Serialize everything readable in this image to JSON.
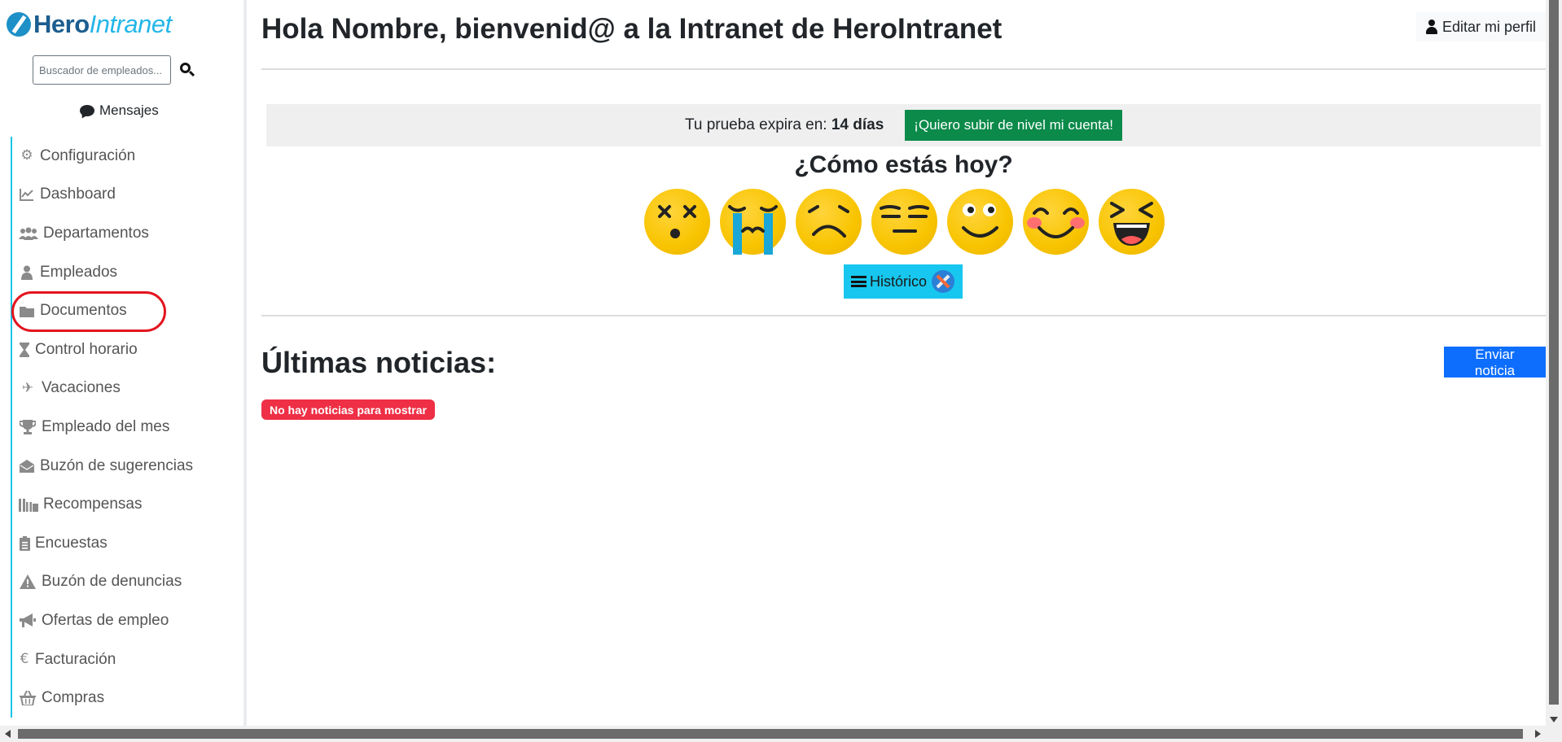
{
  "logo": {
    "hero": "Hero",
    "intranet": "Intranet"
  },
  "search": {
    "placeholder": "Buscador de empleados..."
  },
  "sidebar": {
    "messages_label": "Mensajes",
    "items": [
      {
        "label": "Configuración",
        "icon": "gear-icon"
      },
      {
        "label": "Dashboard",
        "icon": "chart-line-icon"
      },
      {
        "label": "Departamentos",
        "icon": "users-icon"
      },
      {
        "label": "Empleados",
        "icon": "user-icon"
      },
      {
        "label": "Documentos",
        "icon": "folder-icon"
      },
      {
        "label": "Control horario",
        "icon": "hourglass-icon"
      },
      {
        "label": "Vacaciones",
        "icon": "plane-icon"
      },
      {
        "label": "Empleado del mes",
        "icon": "trophy-icon"
      },
      {
        "label": "Buzón de sugerencias",
        "icon": "envelope-open-icon"
      },
      {
        "label": "Recompensas",
        "icon": "gifts-icon"
      },
      {
        "label": "Encuestas",
        "icon": "clipboard-list-icon"
      },
      {
        "label": "Buzón de denuncias",
        "icon": "warning-icon"
      },
      {
        "label": "Ofertas de empleo",
        "icon": "megaphone-icon"
      },
      {
        "label": "Facturación",
        "icon": "euro-icon"
      },
      {
        "label": "Compras",
        "icon": "basket-icon"
      }
    ]
  },
  "header": {
    "welcome_prefix": "Hola ",
    "welcome_name": "Nombre",
    "welcome_middle": ", bienvenid@ a la Intranet de ",
    "welcome_company": "HeroIntranet",
    "edit_profile": "Editar mi perfil"
  },
  "trial": {
    "text": "Tu prueba expira en: ",
    "days": "14 días",
    "upgrade_button": "¡Quiero subir de nivel mi cuenta!"
  },
  "mood": {
    "title": "¿Cómo estás hoy?",
    "emojis": [
      "dizzy-face-icon",
      "crying-face-icon",
      "frowning-face-icon",
      "expressionless-face-icon",
      "smiling-face-icon",
      "blushing-face-icon",
      "laughing-face-icon"
    ],
    "history_button": "Histórico"
  },
  "news": {
    "title": "Últimas noticias:",
    "send_button": "Enviar noticia",
    "empty_badge": "No hay noticias para mostrar"
  },
  "colors": {
    "accent_cyan": "#17c7ef",
    "upgrade_green": "#0b8a4a",
    "primary_blue": "#0d6efd",
    "danger_red": "#ee2f45",
    "highlight_ring": "#e3151f"
  }
}
